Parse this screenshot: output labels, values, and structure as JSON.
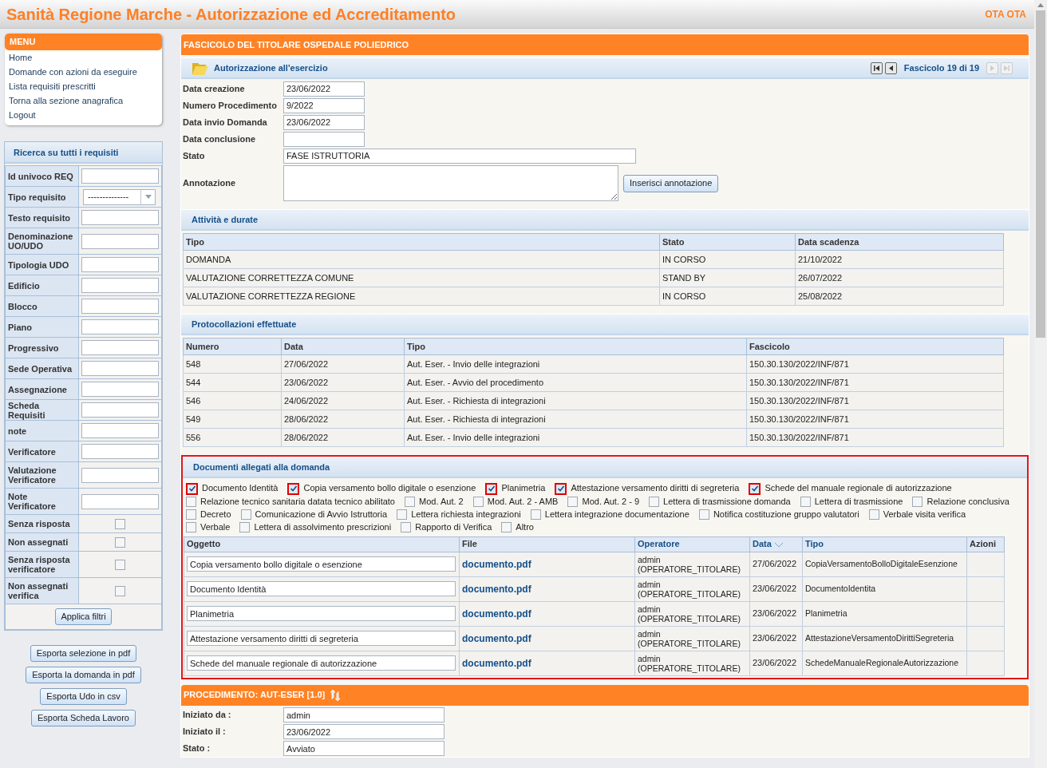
{
  "header": {
    "title": "Sanità Regione Marche - Autorizzazione ed Accreditamento",
    "user": "OTA OTA"
  },
  "menu": {
    "title": "MENU",
    "items": [
      "Home",
      "Domande con azioni da eseguire",
      "Lista requisiti prescritti",
      "Torna alla sezione anagrafica",
      "Logout"
    ]
  },
  "search": {
    "title": "Ricerca su tutti i requisiti",
    "fields": [
      {
        "label": "Id univoco REQ",
        "kind": "text"
      },
      {
        "label": "Tipo requisito",
        "kind": "select",
        "value": "--------------"
      },
      {
        "label": "Testo requisito",
        "kind": "text"
      },
      {
        "label": "Denominazione UO/UDO",
        "kind": "text"
      },
      {
        "label": "Tipologia UDO",
        "kind": "text"
      },
      {
        "label": "Edificio",
        "kind": "text"
      },
      {
        "label": "Blocco",
        "kind": "text"
      },
      {
        "label": "Piano",
        "kind": "text"
      },
      {
        "label": "Progressivo",
        "kind": "text"
      },
      {
        "label": "Sede Operativa",
        "kind": "text"
      },
      {
        "label": "Assegnazione",
        "kind": "text"
      },
      {
        "label": "Scheda Requisiti",
        "kind": "text"
      },
      {
        "label": "note",
        "kind": "text"
      },
      {
        "label": "Verificatore",
        "kind": "text"
      },
      {
        "label": "Valutazione Verificatore",
        "kind": "text"
      },
      {
        "label": "Note Verificatore",
        "kind": "text"
      },
      {
        "label": "Senza risposta",
        "kind": "checkbox",
        "checked": false
      },
      {
        "label": "Non assegnati",
        "kind": "checkbox",
        "checked": false
      },
      {
        "label": "Senza risposta verificatore",
        "kind": "checkbox",
        "checked": false
      },
      {
        "label": "Non assegnati verifica",
        "kind": "checkbox",
        "checked": false
      }
    ],
    "apply_button": "Applica filtri"
  },
  "export_buttons": [
    "Esporta selezione in pdf",
    "Esporta la domanda in pdf",
    "Esporta Udo in csv",
    "Esporta Scheda Lavoro"
  ],
  "fascicolo": {
    "title": "FASCICOLO DEL TITOLARE OSPEDALE POLIEDRICO",
    "section_title": "Autorizzazione all'esercizio",
    "pager": "Fascicolo 19 di 19",
    "fields": [
      {
        "label": "Data creazione",
        "value": "23/06/2022",
        "wide": false
      },
      {
        "label": "Numero Procedimento",
        "value": "9/2022",
        "wide": false
      },
      {
        "label": "Data invio Domanda",
        "value": "23/06/2022",
        "wide": false
      },
      {
        "label": "Data conclusione",
        "wide": false
      },
      {
        "label": "Stato",
        "value": "FASE ISTRUTTORIA",
        "wide": true
      }
    ],
    "annotation": {
      "label": "Annotazione",
      "button": "Inserisci annotazione"
    }
  },
  "attivita": {
    "title": "Attività e durate",
    "columns": [
      "Tipo",
      "Stato",
      "Data scadenza"
    ],
    "rows": [
      [
        "DOMANDA",
        "IN CORSO",
        "21/10/2022"
      ],
      [
        "VALUTAZIONE CORRETTEZZA COMUNE",
        "STAND BY",
        "26/07/2022"
      ],
      [
        "VALUTAZIONE CORRETTEZZA REGIONE",
        "IN CORSO",
        "25/08/2022"
      ]
    ]
  },
  "protocollazioni": {
    "title": "Protocollazioni effettuate",
    "columns": [
      "Numero",
      "Data",
      "Tipo",
      "Fascicolo"
    ],
    "rows": [
      [
        "548",
        "27/06/2022",
        "Aut. Eser. - Invio delle integrazioni",
        "150.30.130/2022/INF/871"
      ],
      [
        "544",
        "23/06/2022",
        "Aut. Eser. - Avvio del procedimento",
        "150.30.130/2022/INF/871"
      ],
      [
        "546",
        "24/06/2022",
        "Aut. Eser. - Richiesta di integrazioni",
        "150.30.130/2022/INF/871"
      ],
      [
        "549",
        "28/06/2022",
        "Aut. Eser. - Richiesta di integrazioni",
        "150.30.130/2022/INF/871"
      ],
      [
        "556",
        "28/06/2022",
        "Aut. Eser. - Invio delle integrazioni",
        "150.30.130/2022/INF/871"
      ]
    ]
  },
  "documenti": {
    "title": "Documenti allegati alla domanda",
    "filters": [
      {
        "label": "Documento Identità",
        "checked": true
      },
      {
        "label": "Copia versamento bollo digitale o esenzione",
        "checked": true
      },
      {
        "label": "Planimetria",
        "checked": true
      },
      {
        "label": "Attestazione versamento diritti di segreteria",
        "checked": true
      },
      {
        "label": "Schede del manuale regionale di autorizzazione",
        "checked": true
      },
      {
        "label": "Relazione tecnico sanitaria datata tecnico abilitato",
        "checked": false
      },
      {
        "label": "Mod. Aut. 2",
        "checked": false
      },
      {
        "label": "Mod. Aut. 2 - AMB",
        "checked": false
      },
      {
        "label": "Mod. Aut. 2 - 9",
        "checked": false
      },
      {
        "label": "Lettera di trasmissione domanda",
        "checked": false
      },
      {
        "label": "Lettera di trasmissione",
        "checked": false
      },
      {
        "label": "Relazione conclusiva",
        "checked": false
      },
      {
        "label": "Decreto",
        "checked": false
      },
      {
        "label": "Comunicazione di Avvio Istruttoria",
        "checked": false
      },
      {
        "label": "Lettera richiesta integrazioni",
        "checked": false
      },
      {
        "label": "Lettera integrazione documentazione",
        "checked": false
      },
      {
        "label": "Notifica costituzione gruppo valutatori",
        "checked": false
      },
      {
        "label": "Verbale visita verifica",
        "checked": false
      },
      {
        "label": "Verbale",
        "checked": false
      },
      {
        "label": "Lettera di assolvimento prescrizioni",
        "checked": false
      },
      {
        "label": "Rapporto di Verifica",
        "checked": false
      },
      {
        "label": "Altro",
        "checked": false
      }
    ],
    "columns": [
      {
        "label": "Oggetto",
        "link": false,
        "sorted": false
      },
      {
        "label": "File",
        "link": false,
        "sorted": false
      },
      {
        "label": "Operatore",
        "link": true,
        "sorted": false
      },
      {
        "label": "Data",
        "link": true,
        "sorted": true
      },
      {
        "label": "Tipo",
        "link": true,
        "sorted": false
      },
      {
        "label": "Azioni",
        "link": false,
        "sorted": false
      }
    ],
    "rows": [
      {
        "oggetto": "Copia versamento bollo digitale o esenzione",
        "file": "documento.pdf",
        "operatore": [
          "admin",
          "(OPERATORE_TITOLARE)"
        ],
        "data": "27/06/2022",
        "tipo": "CopiaVersamentoBolloDigitaleEsenzione"
      },
      {
        "oggetto": "Documento Identità",
        "file": "documento.pdf",
        "operatore": [
          "admin",
          "(OPERATORE_TITOLARE)"
        ],
        "data": "23/06/2022",
        "tipo": "DocumentoIdentita"
      },
      {
        "oggetto": "Planimetria",
        "file": "documento.pdf",
        "operatore": [
          "admin",
          "(OPERATORE_TITOLARE)"
        ],
        "data": "23/06/2022",
        "tipo": "Planimetria"
      },
      {
        "oggetto": "Attestazione versamento diritti di segreteria",
        "file": "documento.pdf",
        "operatore": [
          "admin",
          "(OPERATORE_TITOLARE)"
        ],
        "data": "23/06/2022",
        "tipo": "AttestazioneVersamentoDirittiSegreteria"
      },
      {
        "oggetto": "Schede del manuale regionale di autorizzazione",
        "file": "documento.pdf",
        "operatore": [
          "admin",
          "(OPERATORE_TITOLARE)"
        ],
        "data": "23/06/2022",
        "tipo": "SchedeManualeRegionaleAutorizzazione"
      }
    ]
  },
  "procedimento": {
    "title": "PROCEDIMENTO: AUT-ESER [1.0]",
    "fields": [
      {
        "label": "Iniziato da :",
        "value": "admin"
      },
      {
        "label": "Iniziato il :",
        "value": "23/06/2022"
      },
      {
        "label": "Stato :",
        "value": "Avviato"
      }
    ]
  }
}
